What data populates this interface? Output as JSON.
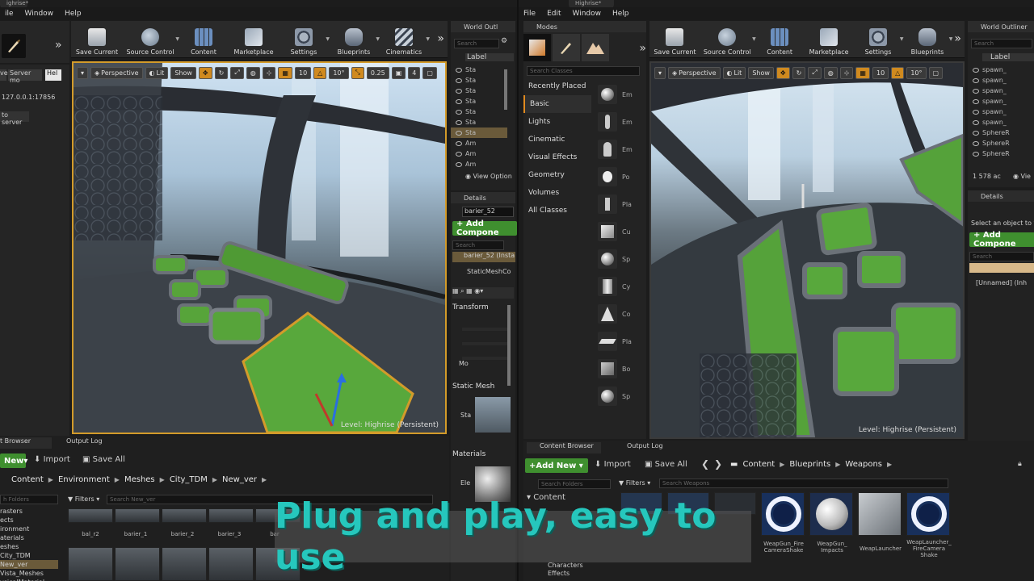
{
  "left": {
    "menu": [
      "ile",
      "Window",
      "Help"
    ],
    "toolbar": [
      {
        "label": "Save Current",
        "icon": "save-icon"
      },
      {
        "label": "Source Control",
        "icon": "source-control-icon"
      },
      {
        "label": "Content",
        "icon": "content-icon"
      },
      {
        "label": "Marketplace",
        "icon": "marketplace-icon"
      },
      {
        "label": "Settings",
        "icon": "settings-icon"
      },
      {
        "label": "Blueprints",
        "icon": "blueprints-icon"
      },
      {
        "label": "Cinematics",
        "icon": "cinematics-icon"
      }
    ],
    "side": {
      "btn1": "ver",
      "btn2": "Server mo",
      "btn3": "Hel",
      "ip": "127.0.0.1:17856",
      "connect": "to server"
    },
    "viewport": {
      "chips": [
        "Perspective",
        "Lit",
        "Show"
      ],
      "grid_snap": "10",
      "rot_snap": "10°",
      "scale_snap": "0.25",
      "cam_speed": "4",
      "level": "Level:  Highrise (Persistent)"
    },
    "outliner": {
      "title": "World Outl",
      "search_ph": "Search",
      "label_col": "Label",
      "rows": [
        "Sta",
        "Sta",
        "Sta",
        "Sta",
        "Sta",
        "Sta",
        "Sta",
        "Am",
        "Am",
        "Am"
      ],
      "view_options": "View Option"
    },
    "details": {
      "title": "Details",
      "name": "barier_52",
      "add": "+ Add Compone",
      "search_ph": "Search",
      "inst": "barier_52 (Insta",
      "comp": "StaticMeshCo",
      "transform": "Transform",
      "mob": "Mo",
      "static_mesh": "Static Mesh",
      "sta": "Sta",
      "materials": "Materials",
      "ele": "Ele"
    },
    "content": {
      "tab1": "t Browser",
      "tab2": "Output Log",
      "add_new": "New",
      "import": "Import",
      "save_all": "Save All",
      "path": [
        "Content",
        "Environment",
        "Meshes",
        "City_TDM",
        "New_ver"
      ],
      "folder_search": "h Folders",
      "filters": "Filters",
      "search_ph": "Search New_ver",
      "folders": [
        "rasters",
        "ects",
        "ironment",
        "aterials",
        "eshes",
        "City_TDM",
        "New_ver",
        "Vista_Meshes",
        "ysicalMaterial"
      ],
      "assets": [
        "bal_r2",
        "barier_1",
        "barier_2",
        "barier_3",
        "bar"
      ]
    }
  },
  "right": {
    "title": "Highrise*",
    "menu": [
      "File",
      "Edit",
      "Window",
      "Help"
    ],
    "modes": {
      "title": "Modes",
      "search_ph": "Search Classes",
      "categories": [
        "Recently Placed",
        "Basic",
        "Lights",
        "Cinematic",
        "Visual Effects",
        "Geometry",
        "Volumes",
        "All Classes"
      ],
      "items": [
        "Em",
        "Em",
        "Em",
        "Po",
        "Pla",
        "Cu",
        "Sp",
        "Cy",
        "Co",
        "Pla",
        "Bo",
        "Sp"
      ]
    },
    "toolbar": [
      {
        "label": "Save Current",
        "icon": "save-icon"
      },
      {
        "label": "Source Control",
        "icon": "source-control-icon"
      },
      {
        "label": "Content",
        "icon": "content-icon"
      },
      {
        "label": "Marketplace",
        "icon": "marketplace-icon"
      },
      {
        "label": "Settings",
        "icon": "settings-icon"
      },
      {
        "label": "Blueprints",
        "icon": "blueprints-icon"
      }
    ],
    "viewport": {
      "chips": [
        "Perspective",
        "Lit",
        "Show"
      ],
      "grid_snap": "10",
      "rot_snap": "10°",
      "level": "Level:  Highrise (Persistent)"
    },
    "outliner": {
      "title": "World Outliner",
      "search_ph": "Search",
      "label_col": "Label",
      "rows": [
        "spawn_",
        "spawn_",
        "spawn_",
        "spawn_",
        "spawn_",
        "spawn_",
        "SphereR",
        "SphereR",
        "SphereR"
      ],
      "count": "1 578 ac",
      "view": "Vie"
    },
    "details": {
      "title": "Details",
      "hint": "Select an object to vi",
      "add": "+ Add Compone",
      "search_ph": "Search",
      "unnamed": "[Unnamed] (Inh"
    },
    "content": {
      "tab1": "Content Browser",
      "tab2": "Output Log",
      "add_new": "Add New",
      "import": "Import",
      "save_all": "Save All",
      "path": [
        "Content",
        "Blueprints",
        "Weapons"
      ],
      "folder_search": "Search Folders",
      "filters": "Filters",
      "search_ph": "Search Weapons",
      "folders": [
        "Content",
        "Characters",
        "Effects"
      ],
      "assets": [
        "WeapGun_Fire CameraShake",
        "WeapGun_ Impacts",
        "WeapLauncher",
        "WeapLauncher_ FireCamera Shake"
      ]
    }
  },
  "slogan": "Plug and play, easy to use",
  "colors": {
    "accent": "#d39b2a",
    "green": "#3f8f2f",
    "slogan": "#26c7bd"
  }
}
